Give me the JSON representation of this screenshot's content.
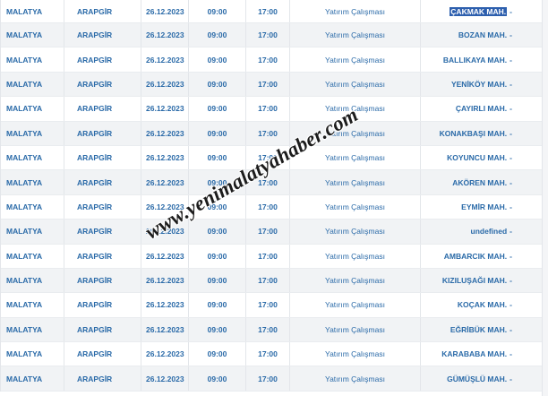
{
  "rows": [
    {
      "city": "MALATYA",
      "district": "ARAPGİR",
      "date": "26.12.2023",
      "start": "09:00",
      "end": "17:00",
      "reason": "Yatırım Çalışması",
      "area": "ÇAKMAK MAH.",
      "suffix": "-",
      "highlighted": true
    },
    {
      "city": "MALATYA",
      "district": "ARAPGİR",
      "date": "26.12.2023",
      "start": "09:00",
      "end": "17:00",
      "reason": "Yatırım Çalışması",
      "area": "BOZAN MAH.",
      "suffix": "-"
    },
    {
      "city": "MALATYA",
      "district": "ARAPGİR",
      "date": "26.12.2023",
      "start": "09:00",
      "end": "17:00",
      "reason": "Yatırım Çalışması",
      "area": "BALLIKAYA MAH.",
      "suffix": "-"
    },
    {
      "city": "MALATYA",
      "district": "ARAPGİR",
      "date": "26.12.2023",
      "start": "09:00",
      "end": "17:00",
      "reason": "Yatırım Çalışması",
      "area": "YENİKÖY MAH.",
      "suffix": "-"
    },
    {
      "city": "MALATYA",
      "district": "ARAPGİR",
      "date": "26.12.2023",
      "start": "09:00",
      "end": "17:00",
      "reason": "Yatırım Çalışması",
      "area": "ÇAYIRLI MAH.",
      "suffix": "-"
    },
    {
      "city": "MALATYA",
      "district": "ARAPGİR",
      "date": "26.12.2023",
      "start": "09:00",
      "end": "17:00",
      "reason": "Yatırım Çalışması",
      "area": "KONAKBAŞI MAH.",
      "suffix": "-"
    },
    {
      "city": "MALATYA",
      "district": "ARAPGİR",
      "date": "26.12.2023",
      "start": "09:00",
      "end": "17:00",
      "reason": "Yatırım Çalışması",
      "area": "KOYUNCU MAH.",
      "suffix": "-"
    },
    {
      "city": "MALATYA",
      "district": "ARAPGİR",
      "date": "26.12.2023",
      "start": "09:00",
      "end": "17:00",
      "reason": "Yatırım Çalışması",
      "area": "AKÖREN MAH.",
      "suffix": "-"
    },
    {
      "city": "MALATYA",
      "district": "ARAPGİR",
      "date": "26.12.2023",
      "start": "09:00",
      "end": "17:00",
      "reason": "Yatırım Çalışması",
      "area": "EYMİR MAH.",
      "suffix": "-"
    },
    {
      "city": "MALATYA",
      "district": "ARAPGİR",
      "date": "26.12.2023",
      "start": "09:00",
      "end": "17:00",
      "reason": "Yatırım Çalışması",
      "area": "undefined",
      "suffix": "-"
    },
    {
      "city": "MALATYA",
      "district": "ARAPGİR",
      "date": "26.12.2023",
      "start": "09:00",
      "end": "17:00",
      "reason": "Yatırım Çalışması",
      "area": "AMBARCIK MAH.",
      "suffix": "-"
    },
    {
      "city": "MALATYA",
      "district": "ARAPGİR",
      "date": "26.12.2023",
      "start": "09:00",
      "end": "17:00",
      "reason": "Yatırım Çalışması",
      "area": "KIZILUŞAĞI MAH.",
      "suffix": "-"
    },
    {
      "city": "MALATYA",
      "district": "ARAPGİR",
      "date": "26.12.2023",
      "start": "09:00",
      "end": "17:00",
      "reason": "Yatırım Çalışması",
      "area": "KOÇAK MAH.",
      "suffix": "-"
    },
    {
      "city": "MALATYA",
      "district": "ARAPGİR",
      "date": "26.12.2023",
      "start": "09:00",
      "end": "17:00",
      "reason": "Yatırım Çalışması",
      "area": "EĞRİBÜK MAH.",
      "suffix": "-"
    },
    {
      "city": "MALATYA",
      "district": "ARAPGİR",
      "date": "26.12.2023",
      "start": "09:00",
      "end": "17:00",
      "reason": "Yatırım Çalışması",
      "area": "KARABABA MAH.",
      "suffix": "-"
    },
    {
      "city": "MALATYA",
      "district": "ARAPGİR",
      "date": "26.12.2023",
      "start": "09:00",
      "end": "17:00",
      "reason": "Yatırım Çalışması",
      "area": "GÜMÜŞLÜ MAH.",
      "suffix": "-"
    }
  ],
  "watermark": "www.yenimalatyahaber.com",
  "colors": {
    "text": "#2a6aa8",
    "highlight": "#2d5fae",
    "row_alt": "#f1f3f5"
  }
}
